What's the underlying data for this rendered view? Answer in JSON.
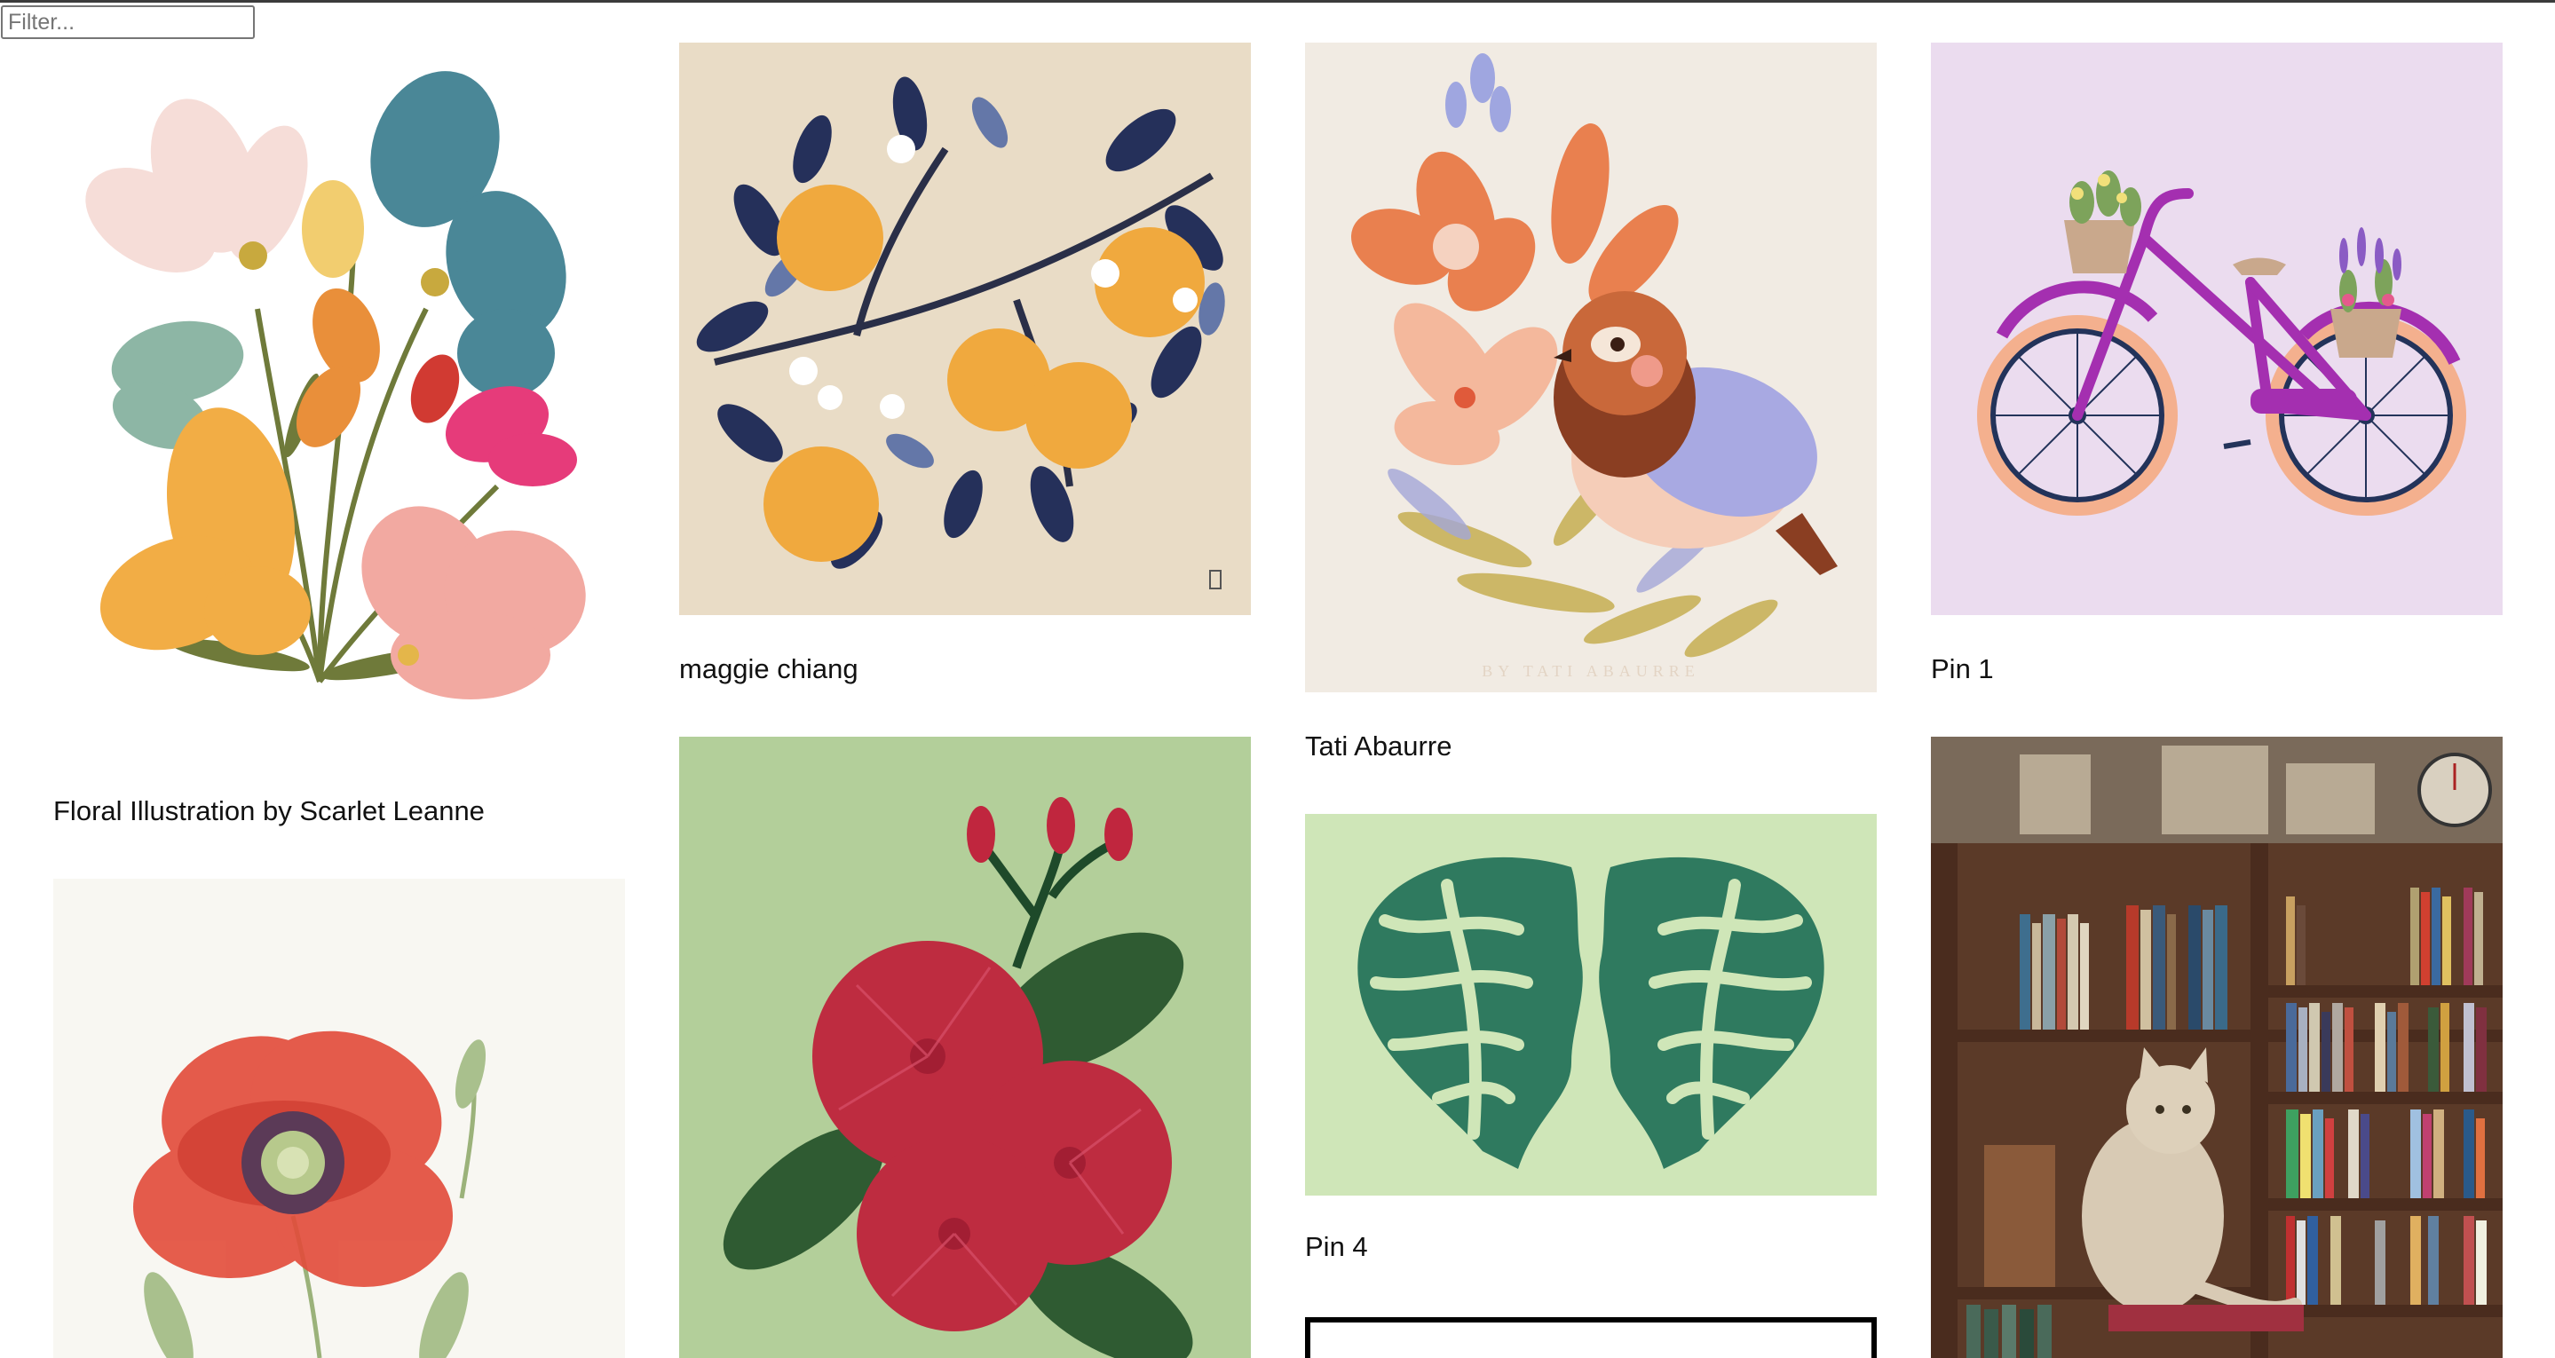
{
  "filter": {
    "placeholder": "Filter...",
    "value": ""
  },
  "pins": [
    {
      "caption": "Floral Illustration by Scarlet Leanne",
      "image": "floral-illustration",
      "bg": "#ffffff"
    },
    {
      "caption": "",
      "image": "poppy-watercolor",
      "bg": "#f8f7f2"
    },
    {
      "caption": "maggie chiang",
      "image": "orange-branch",
      "bg": "#e9dcc6"
    },
    {
      "caption": "",
      "image": "red-hibiscus",
      "bg": "#b3cf9a"
    },
    {
      "caption": "Tati Abaurre",
      "image": "bird-and-flowers",
      "bg": "#f1ebe3",
      "watermark": "BY TATI ABAURRE"
    },
    {
      "caption": "Pin 4",
      "image": "mirrored-faces",
      "bg": "#cfe6b8"
    },
    {
      "caption": "",
      "image": "outlined-card",
      "bg": "#ffffff"
    },
    {
      "caption": "Pin 1",
      "image": "bicycle",
      "bg": "#ebdcef"
    },
    {
      "caption": "",
      "image": "bookshelf-cat",
      "bg": "#5b3a28"
    }
  ],
  "colors": {
    "text": "#111111",
    "border": "#767676",
    "page_bg": "#ffffff"
  }
}
